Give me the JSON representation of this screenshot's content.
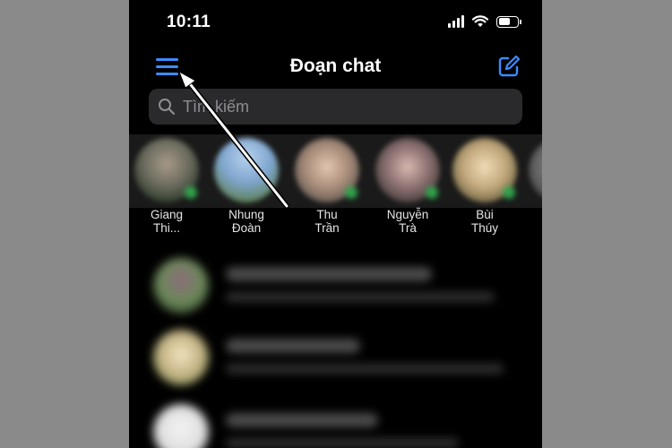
{
  "status_bar": {
    "time": "10:11"
  },
  "header": {
    "title": "Đoạn chat"
  },
  "search": {
    "placeholder": "Tìm kiếm"
  },
  "stories": [
    {
      "line1": "Giang",
      "line2": "Thi..."
    },
    {
      "line1": "Nhung",
      "line2": "Đoàn"
    },
    {
      "line1": "Thu",
      "line2": "Trần"
    },
    {
      "line1": "Nguyễn",
      "line2": "Trà"
    },
    {
      "line1": "Bùi",
      "line2": "Thúy"
    }
  ],
  "colors": {
    "accent": "#3d8bff",
    "online": "#31a24c",
    "background": "#000000",
    "outer_background": "#8a8a8a"
  },
  "icons": [
    "signal-icon",
    "wifi-icon",
    "battery-icon",
    "menu-icon",
    "compose-icon",
    "search-icon"
  ]
}
